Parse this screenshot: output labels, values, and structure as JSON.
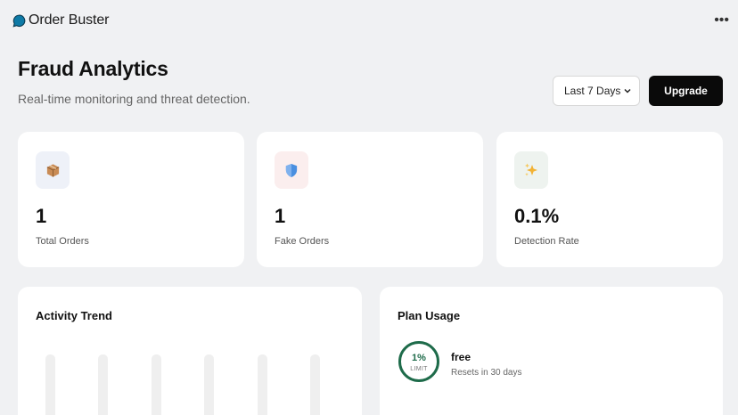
{
  "app": {
    "name": "Order Buster",
    "more_icon": "more-horizontal-icon"
  },
  "header": {
    "title": "Fraud Analytics",
    "subtitle": "Real-time monitoring and threat detection."
  },
  "controls": {
    "range_value": "Last 7 Days",
    "upgrade_label": "Upgrade"
  },
  "stats": [
    {
      "value": "1",
      "label": "Total Orders",
      "icon": "package-icon",
      "badge_color": "#eef1f8"
    },
    {
      "value": "1",
      "label": "Fake Orders",
      "icon": "shield-icon",
      "badge_color": "#fbeeee"
    },
    {
      "value": "0.1%",
      "label": "Detection Rate",
      "icon": "sparkles-icon",
      "badge_color": "#eef3ef"
    }
  ],
  "activity": {
    "title": "Activity Trend"
  },
  "plan": {
    "title": "Plan Usage",
    "usage_percent": "1%",
    "usage_fraction": 0.01,
    "usage_unit": "LIMIT",
    "plan_name": "free",
    "reset_text": "Resets in 30 days",
    "ring_color": "#1e6b4a"
  },
  "colors": {
    "accent": "#0a0a0a",
    "background": "#f0f1f3"
  }
}
